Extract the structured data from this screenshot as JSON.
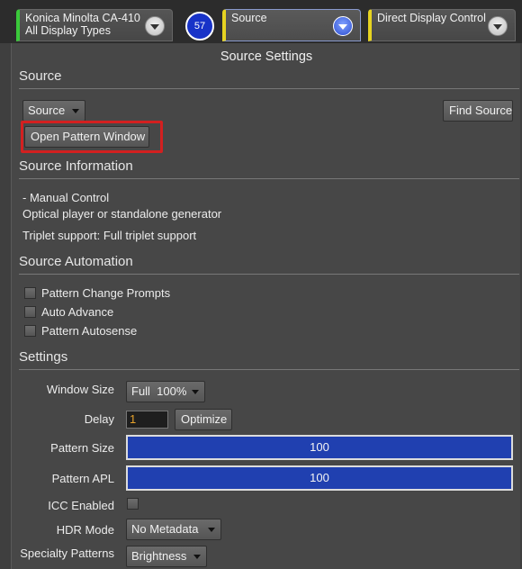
{
  "tabs": {
    "meter": {
      "line1": "Konica Minolta CA-410",
      "line2": "All Display Types",
      "accent": "#3ac93a"
    },
    "badge": "57",
    "source": {
      "label": "Source",
      "accent": "#e6d321"
    },
    "ddc": {
      "label": "Direct Display Control",
      "accent": "#e6d321"
    }
  },
  "panel": {
    "title": "Source Settings"
  },
  "source_section": {
    "heading": "Source",
    "source_select": "Source",
    "find_source": "Find Source",
    "open_pattern_window": "Open Pattern Window"
  },
  "source_info": {
    "heading": "Source Information",
    "lines": [
      "- Manual Control",
      "Optical player or standalone generator",
      "Triplet support: Full triplet support"
    ]
  },
  "automation": {
    "heading": "Source Automation",
    "options": [
      {
        "label": "Pattern Change Prompts",
        "checked": false
      },
      {
        "label": "Auto Advance",
        "checked": false
      },
      {
        "label": "Pattern Autosense",
        "checked": false
      }
    ]
  },
  "settings": {
    "heading": "Settings",
    "window_size": {
      "label": "Window Size",
      "value": "Full  100%"
    },
    "delay": {
      "label": "Delay",
      "value": "1",
      "optimize": "Optimize"
    },
    "pattern_size": {
      "label": "Pattern Size",
      "value": "100"
    },
    "pattern_apl": {
      "label": "Pattern APL",
      "value": "100"
    },
    "icc_enabled": {
      "label": "ICC Enabled",
      "checked": false
    },
    "hdr_mode": {
      "label": "HDR Mode",
      "value": "No Metadata"
    },
    "specialty_patterns": {
      "label": "Specialty Patterns",
      "value": "Brightness"
    }
  }
}
